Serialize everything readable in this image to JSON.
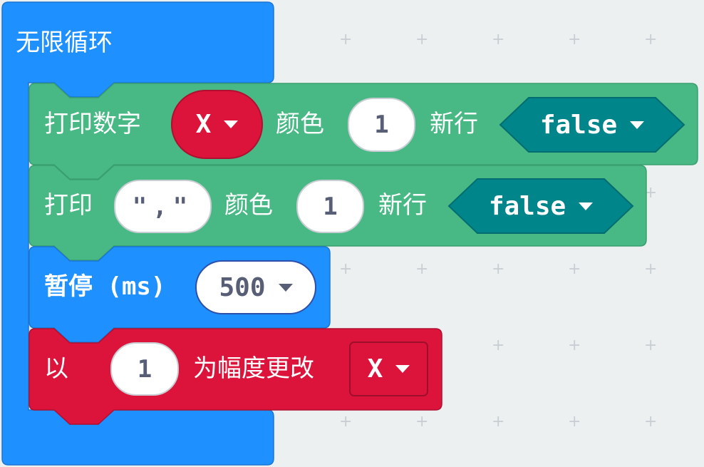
{
  "forever_block": {
    "label": "无限循环",
    "color": "#1e90ff"
  },
  "block_print_number": {
    "label": "打印数字",
    "variable": "X",
    "color_label": "颜色",
    "color_value": "1",
    "newline_label": "新行",
    "newline_value": "false",
    "color": "#48b884"
  },
  "block_print_text": {
    "label": "打印",
    "text_value": "\",\"",
    "color_label": "颜色",
    "color_value": "1",
    "newline_label": "新行",
    "newline_value": "false"
  },
  "block_pause": {
    "label": "暂停 (ms)",
    "value": "500"
  },
  "block_change": {
    "prefix": "以",
    "amount": "1",
    "label": "为幅度更改",
    "variable": "X",
    "color": "#dc143c"
  },
  "colors": {
    "loops": "#1e90ff",
    "serial": "#48b884",
    "bool_dropdown": "#00858a",
    "variables": "#dc143c",
    "workspace": "#ecf0f1"
  }
}
